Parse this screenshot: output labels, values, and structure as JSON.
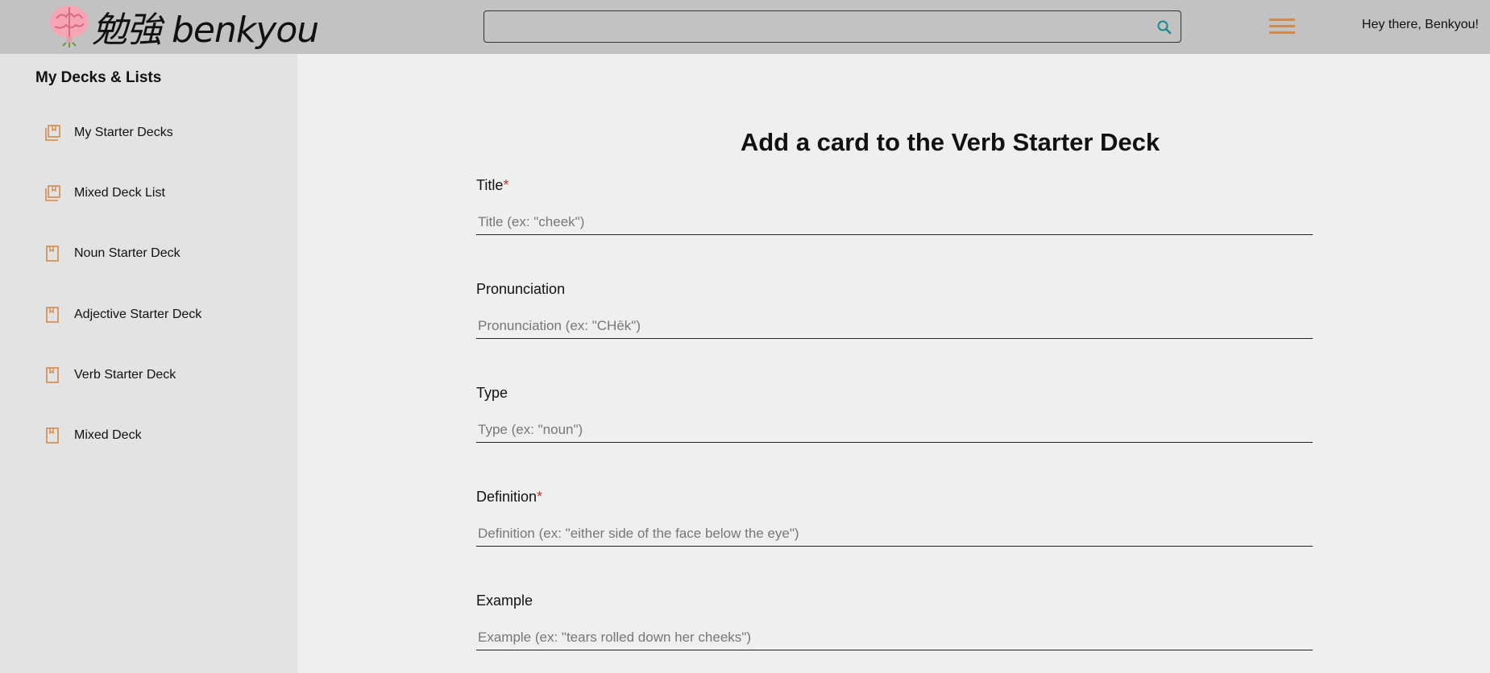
{
  "header": {
    "logo_text": "勉強 benkyou",
    "search": {
      "value": "",
      "placeholder": ""
    },
    "greeting": "Hey there, Benkyou!"
  },
  "sidebar": {
    "title": "My Decks & Lists",
    "items": [
      {
        "label": "My Starter Decks",
        "icon": "deck-list-icon"
      },
      {
        "label": "Mixed Deck List",
        "icon": "deck-list-icon"
      },
      {
        "label": "Noun Starter Deck",
        "icon": "deck-icon"
      },
      {
        "label": "Adjective Starter Deck",
        "icon": "deck-icon"
      },
      {
        "label": "Verb Starter Deck",
        "icon": "deck-icon"
      },
      {
        "label": "Mixed Deck",
        "icon": "deck-icon"
      }
    ]
  },
  "form": {
    "title": "Add a card to the Verb Starter Deck",
    "required_mark": "*",
    "fields": [
      {
        "label": "Title",
        "required": true,
        "value": "",
        "placeholder": "Title (ex: \"cheek\")"
      },
      {
        "label": "Pronunciation",
        "required": false,
        "value": "",
        "placeholder": "Pronunciation (ex: \"CHēk\")"
      },
      {
        "label": "Type",
        "required": false,
        "value": "",
        "placeholder": "Type (ex: \"noun\")"
      },
      {
        "label": "Definition",
        "required": true,
        "value": "",
        "placeholder": "Definition (ex: \"either side of the face below the eye\")"
      },
      {
        "label": "Example",
        "required": false,
        "value": "",
        "placeholder": "Example (ex: \"tears rolled down her cheeks\")"
      }
    ]
  },
  "colors": {
    "header_bg": "#c2c2c2",
    "sidebar_bg": "#e3e3e3",
    "main_bg": "#efefef",
    "accent_orange": "#d4894a",
    "search_icon": "#1a8a8a",
    "required": "#c0392b"
  }
}
